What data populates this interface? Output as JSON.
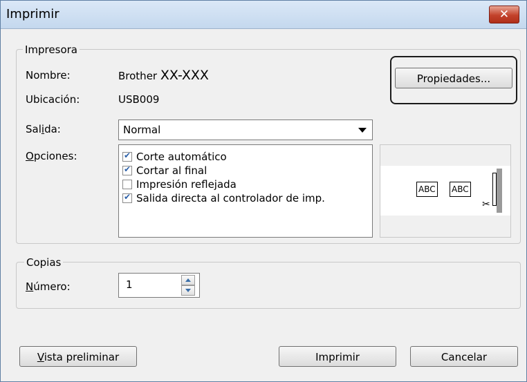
{
  "window": {
    "title": "Imprimir",
    "close_glyph": "✕"
  },
  "printer": {
    "legend": "Impresora",
    "name_label": "Nombre:",
    "name_prefix": "Brother",
    "name_model": "XX-XXX",
    "location_label": "Ubicación:",
    "location_value": "USB009",
    "properties_button": "Propiedades...",
    "output_label_pre": "Sal",
    "output_label_u": "i",
    "output_label_post": "da:",
    "output_value": "Normal",
    "options_label_u": "O",
    "options_label_post": "pciones:",
    "options": [
      {
        "label": "Corte automático",
        "checked": true
      },
      {
        "label": "Cortar al final",
        "checked": true
      },
      {
        "label": "Impresión reflejada",
        "checked": false
      },
      {
        "label": "Salida directa al controlador de imp.",
        "checked": true
      }
    ],
    "preview": {
      "label1": "ABC",
      "label2": "ABC",
      "cut_glyph": "✂"
    }
  },
  "copies": {
    "legend": "Copias",
    "number_label_u": "N",
    "number_label_post": "úmero:",
    "number_value": "1"
  },
  "buttons": {
    "preview_u": "V",
    "preview_post": "ista preliminar",
    "print": "Imprimir",
    "cancel": "Cancelar"
  },
  "icons": {
    "close": "close-icon",
    "dropdown": "chevron-down-icon",
    "scissors": "scissors-icon"
  },
  "colors": {
    "close_button": "#c3422b",
    "titlebar": "#c4d8ee",
    "checkbox_check": "#2a5fa8"
  }
}
